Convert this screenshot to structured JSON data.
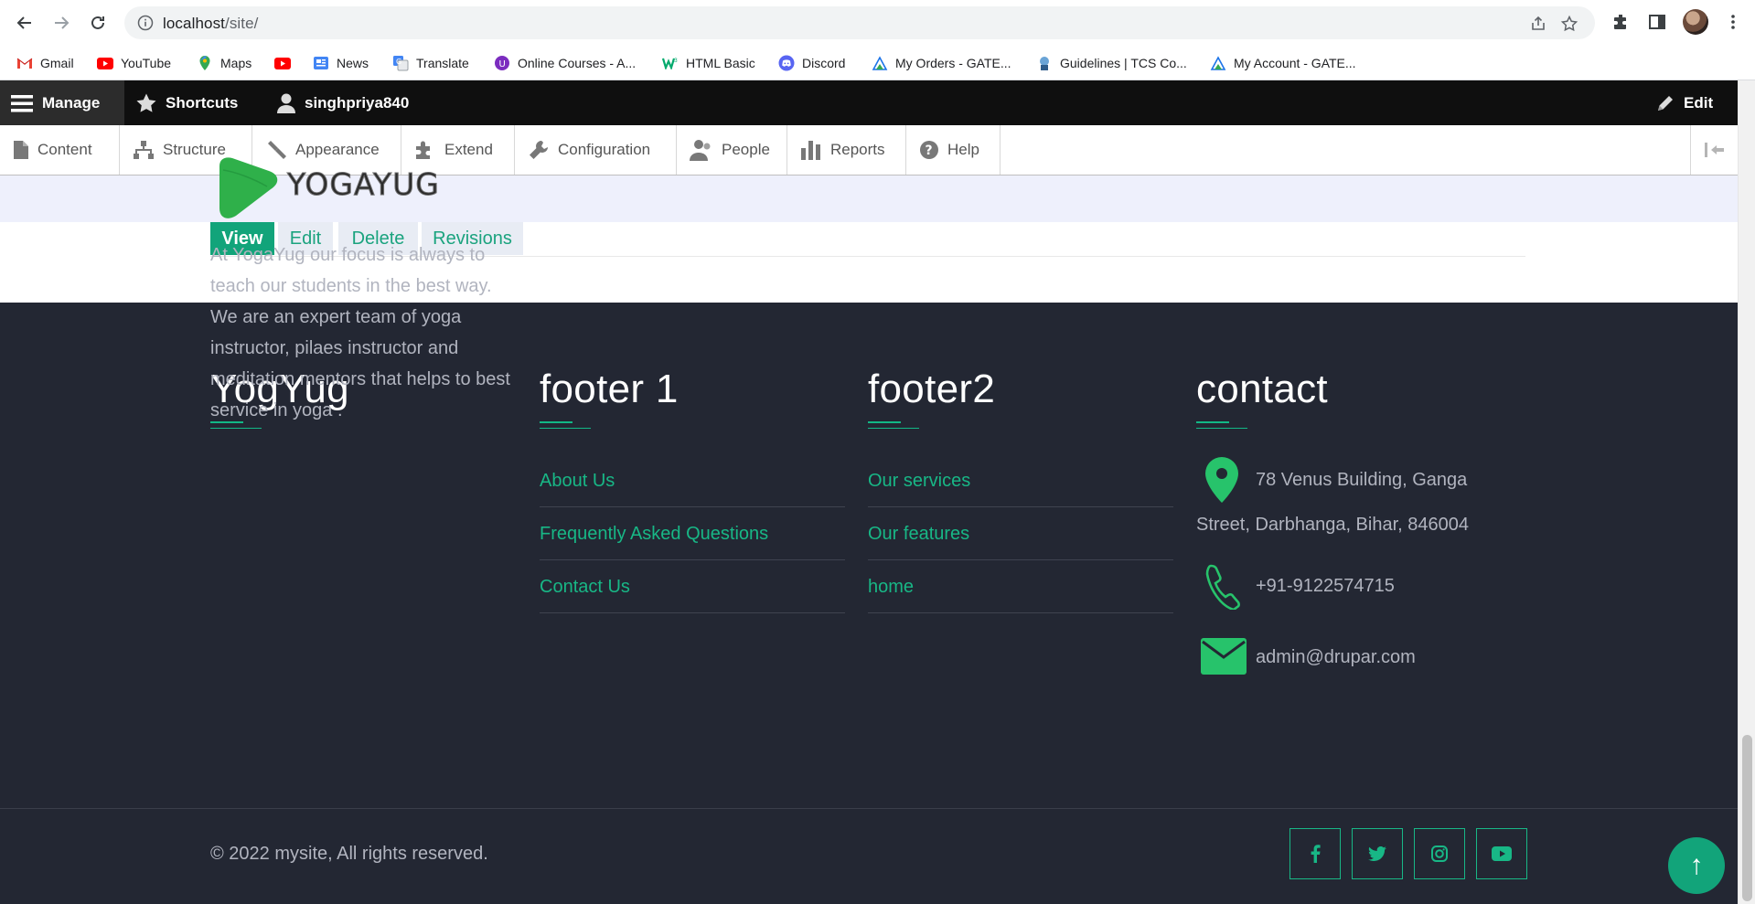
{
  "browser": {
    "url_host": "localhost",
    "url_path": "/site/",
    "bookmarks": [
      {
        "label": "Gmail",
        "icon": "gmail-icon"
      },
      {
        "label": "YouTube",
        "icon": "youtube-icon"
      },
      {
        "label": "Maps",
        "icon": "maps-icon"
      },
      {
        "label": "",
        "icon": "youtube-icon"
      },
      {
        "label": "News",
        "icon": "news-icon"
      },
      {
        "label": "Translate",
        "icon": "translate-icon"
      },
      {
        "label": "Online Courses - A...",
        "icon": "courses-icon"
      },
      {
        "label": "HTML Basic",
        "icon": "w3-icon"
      },
      {
        "label": "Discord",
        "icon": "discord-icon"
      },
      {
        "label": "My Orders - GATE...",
        "icon": "gate-icon"
      },
      {
        "label": "Guidelines | TCS Co...",
        "icon": "tcs-icon"
      },
      {
        "label": "My Account - GATE...",
        "icon": "gate-icon"
      }
    ]
  },
  "toolbar": {
    "manage": "Manage",
    "shortcuts": "Shortcuts",
    "user": "singhpriya840",
    "edit": "Edit"
  },
  "tray": {
    "items": [
      {
        "label": "Content",
        "icon": "file-icon"
      },
      {
        "label": "Structure",
        "icon": "sitemap-icon"
      },
      {
        "label": "Appearance",
        "icon": "brush-icon"
      },
      {
        "label": "Extend",
        "icon": "puzzle-icon"
      },
      {
        "label": "Configuration",
        "icon": "wrench-icon"
      },
      {
        "label": "People",
        "icon": "person-icon"
      },
      {
        "label": "Reports",
        "icon": "bar-chart-icon"
      },
      {
        "label": "Help",
        "icon": "question-icon"
      }
    ]
  },
  "tabs": [
    {
      "label": "View",
      "active": true
    },
    {
      "label": "Edit",
      "active": false
    },
    {
      "label": "Delete",
      "active": false
    },
    {
      "label": "Revisions",
      "active": false
    }
  ],
  "footer": {
    "col1": {
      "title": "YogYug",
      "logo_text": "YOGAYUG",
      "about": "At YogaYug our focus is always to teach our students  in the best way. We are an expert team of yoga instructor, pilaes instructor and meditation mentors that helps to best  service in yoga ."
    },
    "col2": {
      "title": "footer 1",
      "links": [
        "About Us",
        "Frequently Asked Questions",
        "Contact Us"
      ]
    },
    "col3": {
      "title": "footer2",
      "links": [
        "Our services",
        "Our features",
        "home"
      ]
    },
    "col4": {
      "title": "contact",
      "address": "78 Venus Building, Ganga",
      "address_line2": "Street, Darbhanga, Bihar, 846004",
      "phone": "+91-9122574715",
      "email": "admin@drupar.com"
    },
    "copyright": "© 2022 mysite, All rights reserved.",
    "social": [
      "facebook-icon",
      "twitter-icon",
      "instagram-icon",
      "youtube-icon"
    ],
    "back_to_top": "↑"
  },
  "colors": {
    "accent": "#12a47a",
    "link": "#18b786",
    "footer_bg": "#232733",
    "toolbar_bg": "#0f0f0f"
  }
}
